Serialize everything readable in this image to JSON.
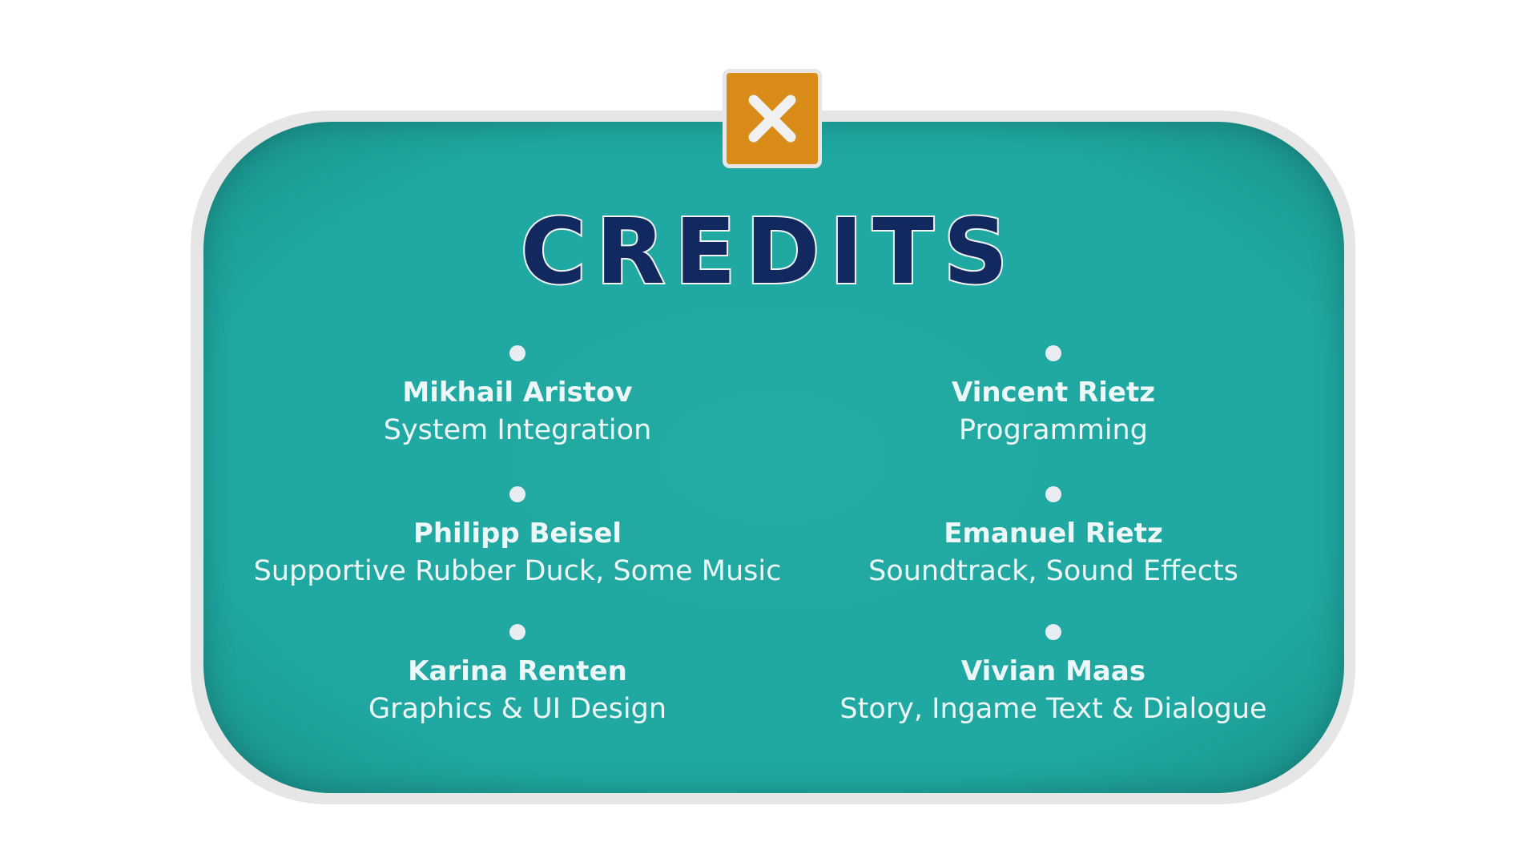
{
  "dialog": {
    "title": "CREDITS",
    "close_label": "X"
  },
  "credits": [
    {
      "name": "Mikhail Aristov",
      "role": "System Integration"
    },
    {
      "name": "Vincent Rietz",
      "role": "Programming"
    },
    {
      "name": "Philipp Beisel",
      "role": "Supportive Rubber Duck, Some Music"
    },
    {
      "name": "Emanuel Rietz",
      "role": "Soundtrack, Sound Effects"
    },
    {
      "name": "Karina Renten",
      "role": "Graphics & UI Design"
    },
    {
      "name": "Vivian Maas",
      "role": "Story, Ingame Text & Dialogue"
    }
  ],
  "colors": {
    "panel_teal": "#1fa8a1",
    "panel_border": "#e6e6e6",
    "close_orange": "#d98c17",
    "title_navy": "#11295e",
    "text_light": "#eef7f7"
  },
  "icons": {
    "close": "close-x-icon",
    "bullet": "bullet-dot-icon"
  }
}
